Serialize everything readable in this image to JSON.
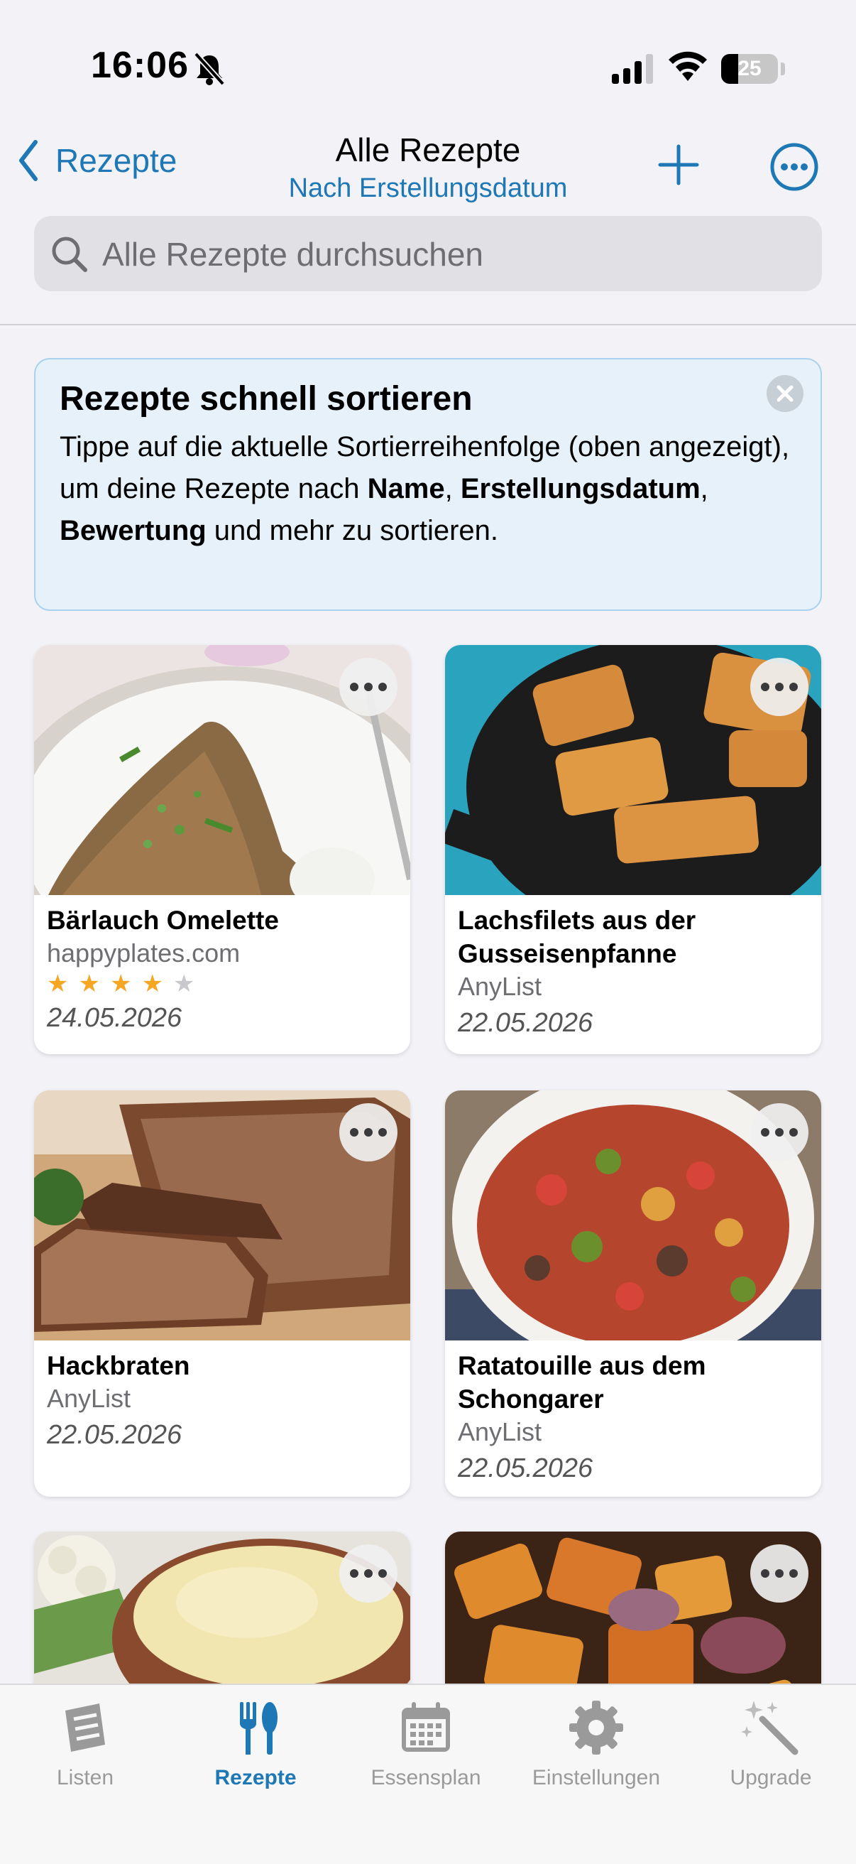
{
  "status_bar": {
    "time": "16:06",
    "battery": "25"
  },
  "nav": {
    "back_label": "Rezepte",
    "title": "Alle Rezepte",
    "subtitle": "Nach Erstellungsdatum"
  },
  "search": {
    "placeholder": "Alle Rezepte durchsuchen"
  },
  "tip": {
    "title": "Rezepte schnell sortieren",
    "body_1": "Tippe auf die aktuelle Sortierreihenfolge (oben angezeigt), um deine Rezepte nach ",
    "bold_1": "Name",
    "body_2": ", ",
    "bold_2": "Erstellungsdatum",
    "body_3": ", ",
    "bold_3": "Bewertung",
    "body_4": " und mehr zu sortieren."
  },
  "recipes": [
    {
      "name": "Bärlauch Omelette",
      "source": "happyplates.com",
      "rating": 4,
      "rating_max": 5,
      "date": "24.05.2026"
    },
    {
      "name": "Lachsfilets aus der Gusseisenpfanne",
      "source": "AnyList",
      "date": "22.05.2026"
    },
    {
      "name": "Hackbraten",
      "source": "AnyList",
      "date": "22.05.2026"
    },
    {
      "name": "Ratatouille aus dem Schongarer",
      "source": "AnyList",
      "date": "22.05.2026"
    }
  ],
  "tabs": [
    {
      "label": "Listen",
      "icon": "list-icon"
    },
    {
      "label": "Rezepte",
      "icon": "fork-knife-icon",
      "active": true
    },
    {
      "label": "Essensplan",
      "icon": "calendar-icon"
    },
    {
      "label": "Einstellungen",
      "icon": "gear-icon"
    },
    {
      "label": "Upgrade",
      "icon": "magic-wand-icon"
    }
  ],
  "colors": {
    "accent": "#1d78b5",
    "star": "#f5a623",
    "tip_bg": "#e6f1f9"
  }
}
